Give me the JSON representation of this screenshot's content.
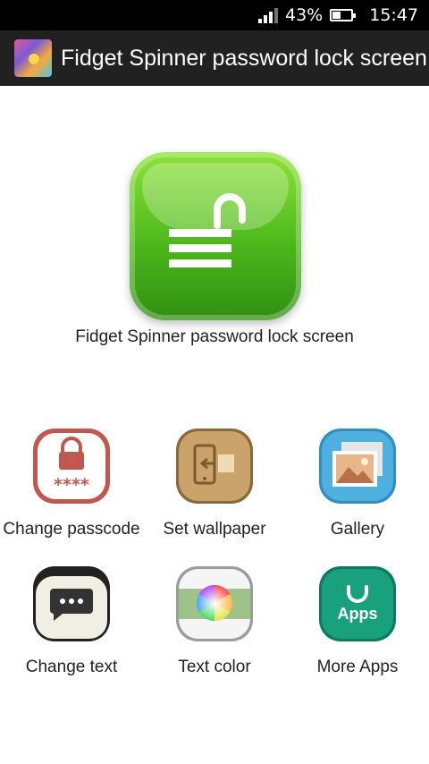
{
  "status_bar": {
    "battery_percent": "43%",
    "time": "15:47"
  },
  "app_bar": {
    "title": "Fidget Spinner password lock screen",
    "logo_icon": "app-logo-icon"
  },
  "hero": {
    "caption": "Fidget Spinner password lock screen",
    "icon": "unlock-icon",
    "color": "#4cb81b"
  },
  "menu": {
    "items": [
      {
        "label": "Change passcode",
        "icon": "passcode-lock-icon",
        "icon_text": "****"
      },
      {
        "label": "Set wallpaper",
        "icon": "set-wallpaper-icon"
      },
      {
        "label": "Gallery",
        "icon": "gallery-icon"
      },
      {
        "label": "Change text",
        "icon": "chat-bubble-icon"
      },
      {
        "label": "Text color",
        "icon": "color-wheel-icon"
      },
      {
        "label": "More Apps",
        "icon": "apps-bag-icon",
        "icon_text": "Apps"
      }
    ]
  }
}
